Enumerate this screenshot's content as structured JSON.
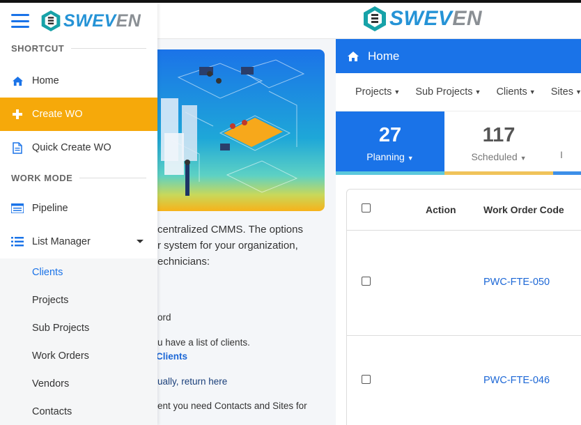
{
  "brand": {
    "logo_part1": "SWEV",
    "logo_part2": "EN",
    "colors": {
      "primary": "#1a73e8",
      "accent": "#f6a90a",
      "logo_blue": "#2593d6",
      "logo_teal": "#17a2a8"
    }
  },
  "sidebar": {
    "menu_icon": "hamburger-icon",
    "sections": {
      "shortcut": "SHORTCUT",
      "work_mode": "WORK MODE"
    },
    "shortcut_items": [
      {
        "label": "Home",
        "icon": "home-icon"
      },
      {
        "label": "Create WO",
        "icon": "plus-icon"
      },
      {
        "label": "Quick Create WO",
        "icon": "document-icon"
      }
    ],
    "work_mode_items": [
      {
        "label": "Pipeline",
        "icon": "pipeline-icon"
      },
      {
        "label": "List Manager",
        "icon": "list-icon"
      }
    ],
    "list_manager_children": [
      {
        "label": "Clients"
      },
      {
        "label": "Projects"
      },
      {
        "label": "Sub Projects"
      },
      {
        "label": "Work Orders"
      },
      {
        "label": "Vendors"
      },
      {
        "label": "Contacts"
      }
    ]
  },
  "intro": {
    "line1": "centralized CMMS. The options",
    "line2": "r system for your organization,",
    "line3": "echnicians:",
    "frag1": "ord",
    "frag2": "u have a list of clients.",
    "frag3": "Clients",
    "frag4": "ually, return here",
    "frag5": "ent you need Contacts and Sites for"
  },
  "panel": {
    "title": "Home",
    "title_icon": "home-icon",
    "filters": [
      "Projects",
      "Sub Projects",
      "Clients",
      "Sites"
    ],
    "stats": [
      {
        "count": "27",
        "label": "Planning"
      },
      {
        "count": "117",
        "label": "Scheduled"
      },
      {
        "count": "",
        "label": "I"
      }
    ],
    "table": {
      "columns": [
        "Action",
        "Work Order Code"
      ],
      "rows": [
        {
          "code": "PWC-FTE-050"
        },
        {
          "code": "PWC-FTE-046"
        }
      ]
    }
  }
}
